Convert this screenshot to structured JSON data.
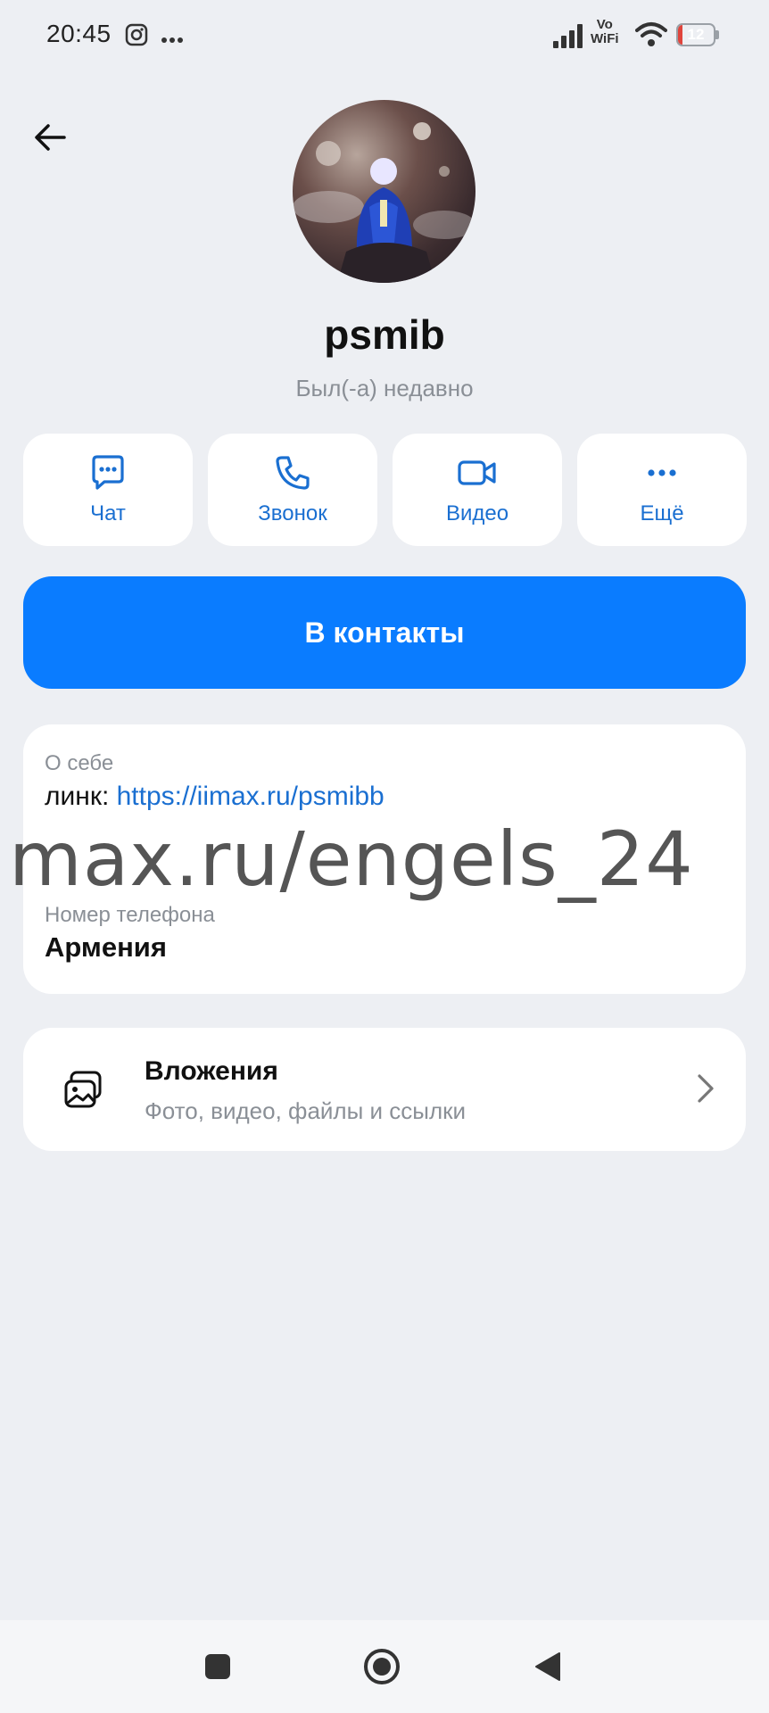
{
  "status_bar": {
    "time": "20:45",
    "network_label_top": "Vo",
    "network_label_bottom": "WiFi",
    "battery_level": "12",
    "battery_fraction": 0.12,
    "notification_icons": [
      "instagram-icon",
      "more-dots-icon"
    ]
  },
  "profile": {
    "username": "psmib",
    "last_seen": "Был(-а) недавно"
  },
  "actions": [
    {
      "label": "Чат",
      "icon": "chat-icon"
    },
    {
      "label": "Звонок",
      "icon": "phone-icon"
    },
    {
      "label": "Видео",
      "icon": "video-icon"
    },
    {
      "label": "Ещё",
      "icon": "more-icon"
    }
  ],
  "add_contact": {
    "label": "В контакты"
  },
  "info": {
    "about_label": "О себе",
    "about_prefix": "линк: ",
    "about_link": "https://iimax.ru/psmibb",
    "phone_label": "Номер телефона",
    "phone_value": "Армения"
  },
  "watermark": "max.ru/engels_24",
  "attachments": {
    "title": "Вложения",
    "subtitle": "Фото, видео, файлы и ссылки"
  },
  "colors": {
    "background": "#edeff3",
    "accent": "#0a7cff",
    "link": "#1a6fd1",
    "battery_low": "#e0443c"
  },
  "nav_bar": [
    "recents-square-icon",
    "home-circle-icon",
    "back-triangle-icon"
  ]
}
